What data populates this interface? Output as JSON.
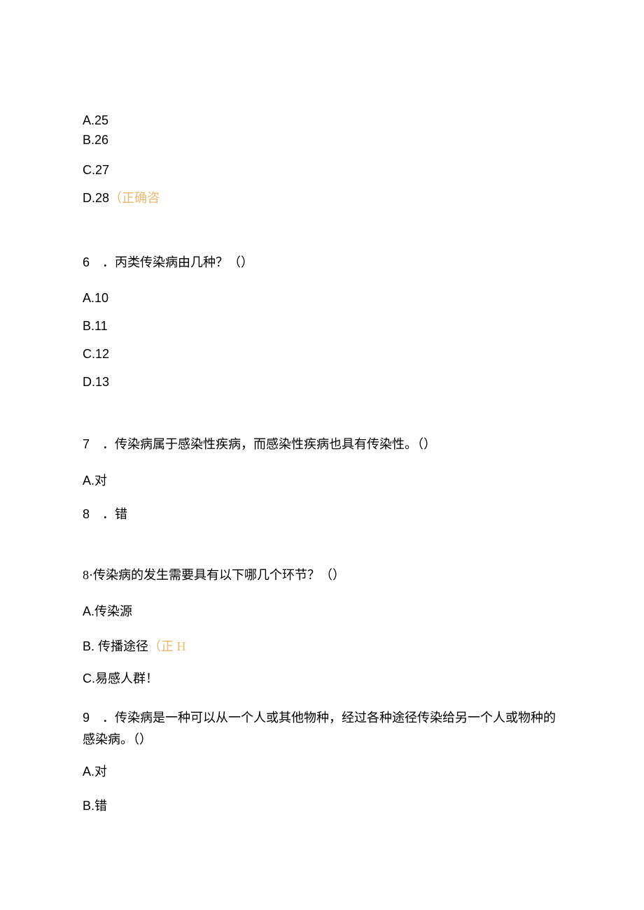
{
  "q5": {
    "a": "A.25",
    "b": "B.26",
    "c": "C.27",
    "d_prefix": "D.28",
    "d_highlight": "（正确咨"
  },
  "q6": {
    "num": "6",
    "title": "．丙类传染病由几种？（）",
    "a": "A.10",
    "b": "B.11",
    "c": "C.12",
    "d": "D.13"
  },
  "q7": {
    "num": "7",
    "title": "．传染病属于感染性疾病，而感染性疾病也具有传染性。（）",
    "a": "A.对",
    "b_num": "8",
    "b_text": "．错"
  },
  "q8": {
    "title": "8·传染病的发生需要具有以下哪几个环节？（）",
    "a": "A.传染源",
    "b_prefix": "B. 传播途径",
    "b_highlight": "（正 H",
    "c": "C.易感人群！"
  },
  "q9": {
    "num": "9",
    "title": "．传染病是一种可以从一个人或其他物种，经过各种途径传染给另一个人或物种的感染病。（）",
    "a": "A.对",
    "b": "B.错"
  }
}
